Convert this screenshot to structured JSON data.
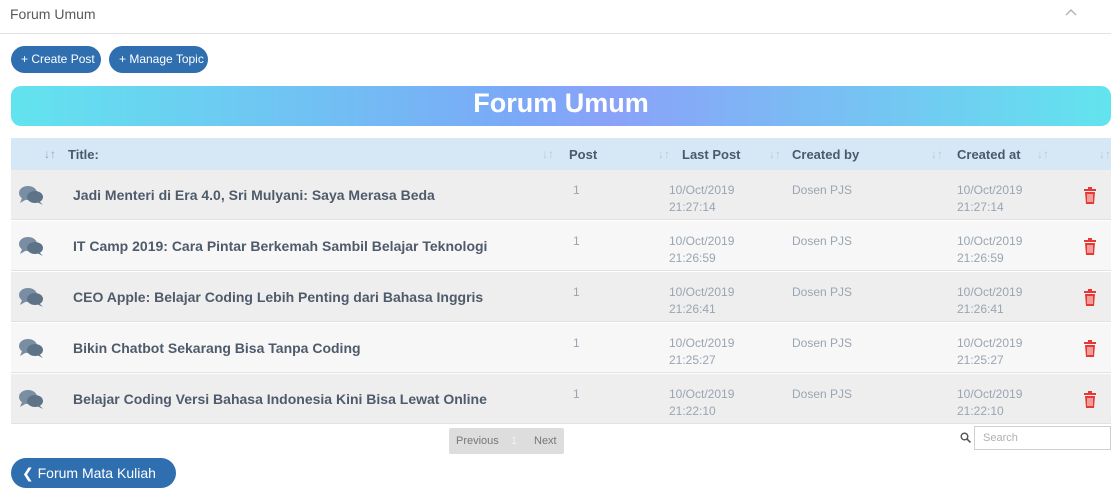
{
  "panel": {
    "title": "Forum Umum"
  },
  "toolbar": {
    "create_post": "+ Create Post",
    "manage_topic": "+ Manage Topic"
  },
  "banner": {
    "title": "Forum Umum"
  },
  "table": {
    "columns": [
      "Title:",
      "Post",
      "Last Post",
      "Created by",
      "Created at"
    ],
    "rows": [
      {
        "title": "Jadi Menteri di Era 4.0, Sri Mulyani: Saya Merasa Beda",
        "post": "1",
        "last_post_date": "10/Oct/2019",
        "last_post_time": "21:27:14",
        "created_by": "Dosen PJS",
        "created_date": "10/Oct/2019",
        "created_time": "21:27:14"
      },
      {
        "title": "IT Camp 2019: Cara Pintar Berkemah Sambil Belajar Teknologi",
        "post": "1",
        "last_post_date": "10/Oct/2019",
        "last_post_time": "21:26:59",
        "created_by": "Dosen PJS",
        "created_date": "10/Oct/2019",
        "created_time": "21:26:59"
      },
      {
        "title": "CEO Apple: Belajar Coding Lebih Penting dari Bahasa Inggris",
        "post": "1",
        "last_post_date": "10/Oct/2019",
        "last_post_time": "21:26:41",
        "created_by": "Dosen PJS",
        "created_date": "10/Oct/2019",
        "created_time": "21:26:41"
      },
      {
        "title": "Bikin Chatbot Sekarang Bisa Tanpa Coding",
        "post": "1",
        "last_post_date": "10/Oct/2019",
        "last_post_time": "21:25:27",
        "created_by": "Dosen PJS",
        "created_date": "10/Oct/2019",
        "created_time": "21:25:27"
      },
      {
        "title": "Belajar Coding Versi Bahasa Indonesia Kini Bisa Lewat Online",
        "post": "1",
        "last_post_date": "10/Oct/2019",
        "last_post_time": "21:22:10",
        "created_by": "Dosen PJS",
        "created_date": "10/Oct/2019",
        "created_time": "21:22:10"
      }
    ]
  },
  "pagination": {
    "previous": "Previous",
    "current_page": "1",
    "next": "Next"
  },
  "search": {
    "placeholder": "Search"
  },
  "footer": {
    "back_button": "Forum Mata Kuliah"
  },
  "icons": {
    "collapse": "chevron-up-icon",
    "row": "chat-bubbles-icon",
    "delete": "trash-icon",
    "search": "search-icon",
    "back": "chevron-left-icon"
  },
  "colors": {
    "button": "#2f6fb0",
    "banner_start": "#62e4ee",
    "banner_mid": "#8aa2f8",
    "header_bg": "#d6e8f6",
    "delete": "#e53935"
  }
}
